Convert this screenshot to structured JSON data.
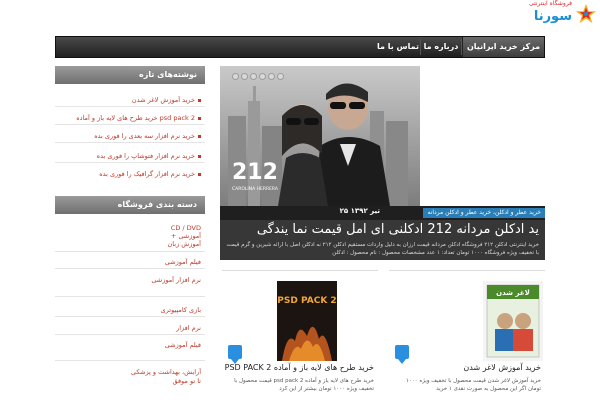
{
  "logo": {
    "brand": "سورنا",
    "tagline": "فروشگاه اینترنتی",
    "colors": {
      "primary": "#1a8fd6",
      "accent": "#e2252b"
    }
  },
  "nav": {
    "items": [
      {
        "label": "مرکز خرید ایرانیان",
        "active": true
      },
      {
        "label": "درباره ما",
        "active": false
      },
      {
        "label": "تماس با ما",
        "active": false
      }
    ]
  },
  "sidebar": {
    "recent_title": "نوشته‌های تازه",
    "recent_links": [
      "خرید آموزش لاغر شدن",
      "خرید طرح های لایه باز و آماده psd pack 2",
      "خرید نرم افزار سه بعدی را فوری بده",
      "خرید نرم افزار فتوشاپ را فوری بده",
      "خرید نرم افزار گرافیک را فوری بده"
    ],
    "categories_title": "دسته بندی فروشگاه",
    "categories": [
      "CD / DVD",
      "+ آموزشی",
      "آموزش زبان",
      "فیلم آموزشی",
      "نرم افزار آموزشی",
      "بازی کامپیوتری",
      "نرم افزار",
      "فیلم آموزشی",
      "آرایش، بهداشت و پزشکی",
      "تا تو موفق"
    ]
  },
  "slider": {
    "category": "خرید عطر و ادکلن مردانه",
    "category2": "خرید عطر و ادکلن",
    "date": "۲۵ تیر ۱۳۹۲",
    "title": "ید ادکلن مردانه 212 ادکلنی ای امل قیمت نما یندگی",
    "excerpt": "خرید اینترنتی ادکلن ۲۱۲ فروشگاه ادکلن مردانه قیمت ارزان به دلیل واردات مستقیم ادکلن ۲۱۲ نه ادکلن اصل با ارائه شیرین و گرم قیمت با تخفیف ویژه فروشگاه ۱۰۰۰ تومان تعداد: ۱ عدد مشخصات محصول : نام محصول : ادکلن",
    "image_brand": "212",
    "image_brand_sub": "CAROLINA HERRERA",
    "dots": 6
  },
  "posts": [
    {
      "title": "PSD PACK 2 خرید طرح های لایه باز و آماده",
      "excerpt": "خرید طرح های لایه باز و آماده psd pack 2 قیمت محصول با تخفیف ویژه ۱۰۰۰ تومان بیشتر از این کرد",
      "thumb_text": "PSD PACK 2"
    },
    {
      "title": "خرید آموزش لاغر شدن",
      "excerpt": "خرید آموزش لاغر شدن قیمت محصول با تخفیف ویژه ۱۰۰۰ تومان اگر این محصول به صورت نقدی ۱ خرید",
      "thumb_text": "لاغر شدن"
    }
  ]
}
